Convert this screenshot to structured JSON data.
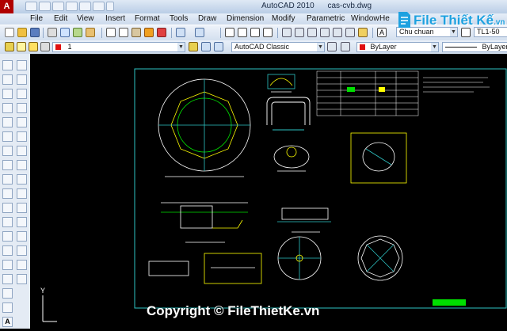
{
  "window": {
    "app_title": "AutoCAD 2010",
    "file_name": "cas-cvb.dwg"
  },
  "menu": [
    "File",
    "Edit",
    "View",
    "Insert",
    "Format",
    "Tools",
    "Draw",
    "Dimension",
    "Modify",
    "Parametric",
    "Window",
    "He"
  ],
  "toolbar": {
    "text_style": "Chu chuan",
    "dim_value": "TL1-50"
  },
  "properties_bar": {
    "layer_value": "1",
    "workspace": "AutoCAD Classic",
    "color_value": "ByLayer",
    "linetype_value": "ByLayer"
  },
  "canvas": {
    "y_axis_label": "Y"
  },
  "watermark": "Copyright © FileThietKe.vn",
  "logo": {
    "text": "File Thiết Kế",
    "suffix": ".vn"
  },
  "colors": {
    "frame": "#2ec4c4",
    "geometry": "#ffffff",
    "accent_yellow": "#ffff00",
    "accent_green": "#00e000"
  }
}
